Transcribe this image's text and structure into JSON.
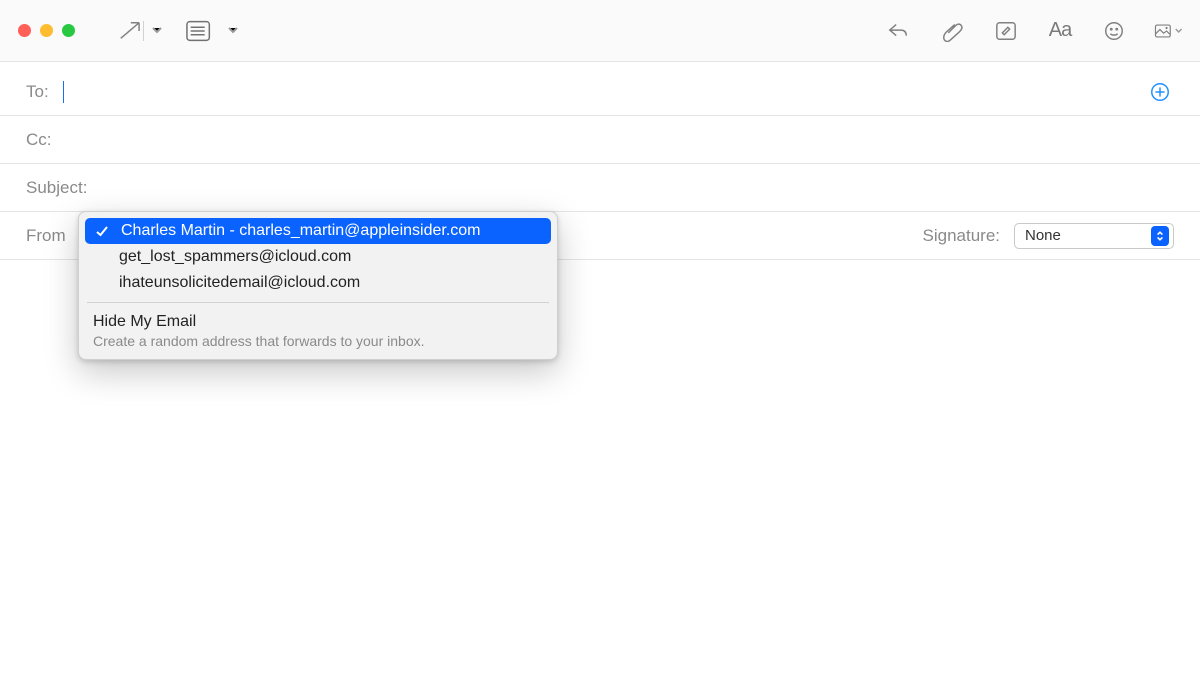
{
  "toolbar": {
    "icons": {
      "send": "send-icon",
      "list": "header-fields-icon",
      "reply": "reply-icon",
      "attach": "paperclip-icon",
      "markup": "markup-icon",
      "font": "font-format-icon",
      "emoji": "emoji-icon",
      "media": "media-browser-icon"
    },
    "font_label": "Aa"
  },
  "fields": {
    "to": {
      "label": "To:",
      "value": ""
    },
    "cc": {
      "label": "Cc:",
      "value": ""
    },
    "subject": {
      "label": "Subject:",
      "value": ""
    },
    "from": {
      "label": "From"
    }
  },
  "signature": {
    "label": "Signature:",
    "value": "None"
  },
  "from_dropdown": {
    "options": [
      {
        "label": "Charles Martin - charles_martin@appleinsider.com",
        "selected": true
      },
      {
        "label": "get_lost_spammers@icloud.com",
        "selected": false
      },
      {
        "label": "ihateunsolicitedemail@icloud.com",
        "selected": false
      }
    ],
    "hide_my_email": {
      "title": "Hide My Email",
      "subtitle": "Create a random address that forwards to your inbox."
    }
  },
  "colors": {
    "accent": "#0a63ff",
    "label_grey": "#8a8a8a"
  }
}
